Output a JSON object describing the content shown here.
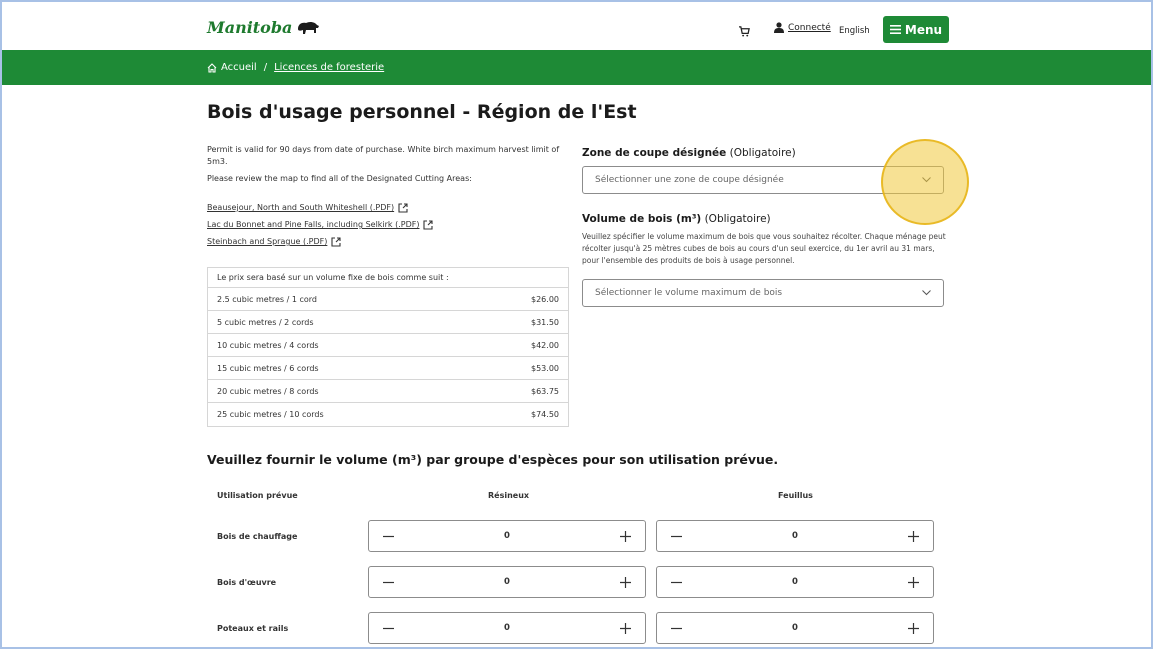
{
  "header": {
    "logo_text": "Manitoba",
    "user_link": "Connecté",
    "language_link": "English",
    "menu_label": "Menu"
  },
  "breadcrumb": {
    "home": "Accueil",
    "separator": "/",
    "current": "Licences de foresterie"
  },
  "page": {
    "title": "Bois d'usage personnel - Région de l'Est",
    "intro_1": "Permit is valid for 90 days from date of purchase. White birch maximum harvest limit of 5m3.",
    "intro_2": "Please review the map to find all of the Designated Cutting Areas:",
    "pdf_links": [
      "Beausejour, North and South Whiteshell (.PDF)",
      "Lac du Bonnet and Pine Falls, including Selkirk (.PDF)",
      "Steinbach and Sprague (.PDF)"
    ]
  },
  "price_table": {
    "heading": "Le prix sera basé sur un volume fixe de bois comme suit :",
    "rows": [
      {
        "label": "2.5 cubic metres / 1 cord",
        "price": "$26.00"
      },
      {
        "label": "5 cubic metres / 2 cords",
        "price": "$31.50"
      },
      {
        "label": "10 cubic metres / 4 cords",
        "price": "$42.00"
      },
      {
        "label": "15 cubic metres / 6 cords",
        "price": "$53.00"
      },
      {
        "label": "20 cubic metres / 8 cords",
        "price": "$63.75"
      },
      {
        "label": "25 cubic metres / 10 cords",
        "price": "$74.50"
      }
    ]
  },
  "zone_field": {
    "label": "Zone de coupe désignée",
    "required": "(Obligatoire)",
    "placeholder": "Sélectionner une zone de coupe désignée"
  },
  "volume_field": {
    "label": "Volume de bois (m³)",
    "required": "(Obligatoire)",
    "helper": "Veuillez spécifier le volume maximum de bois que vous souhaitez récolter. Chaque ménage peut récolter jusqu'à 25 mètres cubes de bois au cours d'un seul exercice, du 1er avril au 31 mars, pour l'ensemble des produits de bois à usage personnel.",
    "placeholder": "Sélectionner le volume maximum de bois"
  },
  "species": {
    "title": "Veuillez fournir le volume (m³) par groupe d'espèces pour son utilisation prévue.",
    "col_use": "Utilisation prévue",
    "col_softwood": "Résineux",
    "col_hardwood": "Feuillus",
    "rows": [
      {
        "label": "Bois de chauffage",
        "softwood": "0",
        "hardwood": "0"
      },
      {
        "label": "Bois d'œuvre",
        "softwood": "0",
        "hardwood": "0"
      },
      {
        "label": "Poteaux et rails",
        "softwood": "0",
        "hardwood": "0"
      }
    ]
  },
  "colors": {
    "brand_green": "#1e8a36",
    "highlight": "#f0c83c"
  }
}
